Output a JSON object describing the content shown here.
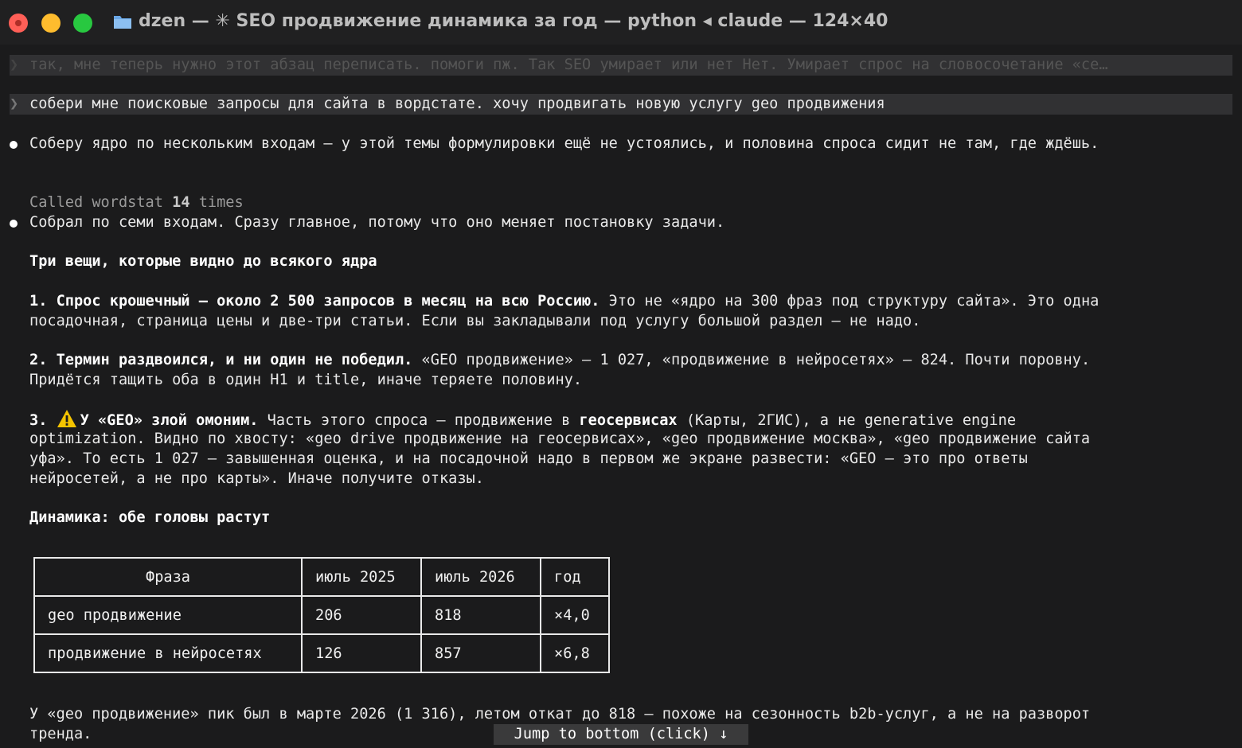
{
  "window": {
    "title": "dzen — ✳ SEO продвижение динамика за год — python ◂ claude — 124×40"
  },
  "history_prompt": "так, мне теперь нужно этот абзац переписать. помоги пж. Так SEO умирает или нет Нет. Умирает спрос на словосочетание «се…",
  "prompt_symbol": "❯",
  "user_prompt": "собери мне поисковые запросы для сайта в вордстате. хочу продвигать новую услугу geo продвижения",
  "msg1": "Соберу ядро по нескольким входам — у этой темы формулировки ещё не устоялись, и половина спроса сидит не там, где ждёшь.",
  "tool_call": {
    "prefix": "Called wordstat ",
    "count": "14",
    "suffix": " times"
  },
  "msg2": "Собрал по семи входам. Сразу главное, потому что оно меняет постановку задачи.",
  "heading1": "Три вещи, которые видно до всякого ядра",
  "p1": {
    "bold": "1. Спрос крошечный — около 2 500 запросов в месяц на всю Россию.",
    "rest1": " Это не «ядро на 300 фраз под структуру сайта». Это одна",
    "line2": "посадочная, страница цены и две-три статьи. Если вы закладывали под услугу большой раздел — не надо."
  },
  "p2": {
    "bold": "2. Термин раздвоился, и ни один не победил.",
    "rest1": " «GEO продвижение» — 1 027, «продвижение в нейросетях» — 824. Почти поровну.",
    "line2": "Придётся тащить оба в один H1 и title, иначе теряете половину."
  },
  "p3": {
    "num": "3. ",
    "icon": "warning-icon",
    "bold": "У «GEO» злой омоним.",
    "rest1a": " Часть этого спроса — продвижение в ",
    "bold2": "геосервисах",
    "rest1b": " (Карты, 2ГИС), а не generative engine",
    "line2": "optimization. Видно по хвосту: «geo drive продвижение на геосервисах», «geo продвижение москва», «geo продвижение сайта",
    "line3": "уфа». То есть 1 027 — завышенная оценка, и на посадочной надо в первом же экране развести: «GEO — это про ответы",
    "line4": "нейросетей, а не про карты». Иначе получите отказы."
  },
  "heading2": "Динамика: обе головы растут",
  "table": {
    "headers": [
      "Фраза",
      "июль 2025",
      "июль 2026",
      "год"
    ],
    "rows": [
      [
        "geo продвижение",
        "206",
        "818",
        "×4,0"
      ],
      [
        "продвижение в нейросетях",
        "126",
        "857",
        "×6,8"
      ]
    ]
  },
  "footer": {
    "line1": "У «geo продвижение» пик был в марте 2026 (1 316), летом откат до 818 — похоже на сезонность b2b-услуг, а не на разворот",
    "line2": "тренда."
  },
  "jump_button": "Jump to bottom (click) ↓",
  "colors": {
    "background": "#1b1b1c",
    "prompt_highlight": "#313133",
    "close": "#ff5f57",
    "minimize": "#febc2e",
    "zoom": "#28c840",
    "warning": "#f5c400"
  }
}
